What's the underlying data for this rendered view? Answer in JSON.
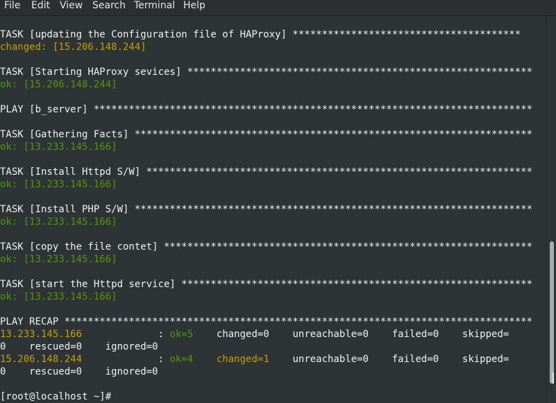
{
  "menu": [
    "File",
    "Edit",
    "View",
    "Search",
    "Terminal",
    "Help"
  ],
  "lines": [
    {
      "segments": [
        {
          "t": "TASK [updating the Configuration file of HAProxy] ***************************************",
          "c": "w"
        }
      ]
    },
    {
      "segments": [
        {
          "t": "changed: [15.206.148.244]",
          "c": "y"
        }
      ]
    },
    {
      "segments": []
    },
    {
      "segments": [
        {
          "t": "TASK [Starting HAProxy sevices] ***********************************************************",
          "c": "w"
        }
      ]
    },
    {
      "segments": [
        {
          "t": "ok: [15.206.148.244]",
          "c": "g"
        }
      ]
    },
    {
      "segments": []
    },
    {
      "segments": [
        {
          "t": "PLAY [b_server] ***************************************************************************",
          "c": "w"
        }
      ]
    },
    {
      "segments": []
    },
    {
      "segments": [
        {
          "t": "TASK [Gathering Facts] ********************************************************************",
          "c": "w"
        }
      ]
    },
    {
      "segments": [
        {
          "t": "ok: [13.233.145.166]",
          "c": "g"
        }
      ]
    },
    {
      "segments": []
    },
    {
      "segments": [
        {
          "t": "TASK [Install Httpd S/W] ******************************************************************",
          "c": "w"
        }
      ]
    },
    {
      "segments": [
        {
          "t": "ok: [13.233.145.166]",
          "c": "g"
        }
      ]
    },
    {
      "segments": []
    },
    {
      "segments": [
        {
          "t": "TASK [Install PHP S/W] ********************************************************************",
          "c": "w"
        }
      ]
    },
    {
      "segments": [
        {
          "t": "ok: [13.233.145.166]",
          "c": "g"
        }
      ]
    },
    {
      "segments": []
    },
    {
      "segments": [
        {
          "t": "TASK [copy the file contet] ***************************************************************",
          "c": "w"
        }
      ]
    },
    {
      "segments": [
        {
          "t": "ok: [13.233.145.166]",
          "c": "g"
        }
      ]
    },
    {
      "segments": []
    },
    {
      "segments": [
        {
          "t": "TASK [start the Httpd service] ************************************************************",
          "c": "w"
        }
      ]
    },
    {
      "segments": [
        {
          "t": "ok: [13.233.145.166]",
          "c": "g"
        }
      ]
    },
    {
      "segments": []
    },
    {
      "segments": [
        {
          "t": "PLAY RECAP ********************************************************************************",
          "c": "w"
        }
      ]
    },
    {
      "segments": [
        {
          "t": "13.233.145.166",
          "c": "y"
        },
        {
          "t": "             : ",
          "c": "w"
        },
        {
          "t": "ok=5",
          "c": "g"
        },
        {
          "t": "    changed=0    unreachable=0    failed=0    skipped=",
          "c": "w"
        }
      ]
    },
    {
      "segments": [
        {
          "t": "0    rescued=0    ignored=0",
          "c": "w"
        }
      ]
    },
    {
      "segments": [
        {
          "t": "15.206.148.244",
          "c": "y"
        },
        {
          "t": "             : ",
          "c": "w"
        },
        {
          "t": "ok=4",
          "c": "g"
        },
        {
          "t": "    ",
          "c": "w"
        },
        {
          "t": "changed=1",
          "c": "y"
        },
        {
          "t": "    unreachable=0    failed=0    skipped=",
          "c": "w"
        }
      ]
    },
    {
      "segments": [
        {
          "t": "0    rescued=0    ignored=0",
          "c": "w"
        }
      ]
    },
    {
      "segments": []
    },
    {
      "segments": [
        {
          "t": "[root@localhost ~]# ",
          "c": "w"
        }
      ]
    }
  ]
}
